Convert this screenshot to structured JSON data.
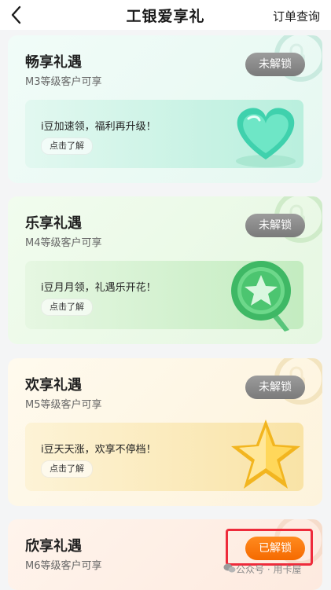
{
  "header": {
    "title": "工银爱享礼",
    "order_link": "订单查询"
  },
  "cards": [
    {
      "title": "畅享礼遇",
      "subtitle": "M3等级客户可享",
      "badge": "未解锁",
      "banner_text": "i豆加速领，福利再升级！",
      "button": "点击了解",
      "art": "heart-icon",
      "colors": {
        "bg": "#eefbf6",
        "banner": "#c9f3e6"
      }
    },
    {
      "title": "乐享礼遇",
      "subtitle": "M4等级客户可享",
      "badge": "未解锁",
      "banner_text": "i豆月月领，礼遇乐开花！",
      "button": "点击了解",
      "art": "star-medal-icon",
      "colors": {
        "bg": "#effbec",
        "banner": "#cfeecb"
      }
    },
    {
      "title": "欢享礼遇",
      "subtitle": "M5等级客户可享",
      "badge": "未解锁",
      "banner_text": "i豆天天涨，欢享不停档！",
      "button": "点击了解",
      "art": "gold-star-icon",
      "colors": {
        "bg": "#fdf8ea",
        "banner": "#fbedbd"
      }
    },
    {
      "title": "欣享礼遇",
      "subtitle": "M6等级客户可享",
      "badge": "已解锁",
      "colors": {
        "bg": "#fdf1ea"
      }
    }
  ],
  "watermark": "公众号 · 用卡屋",
  "colors": {
    "locked_badge": "#8a8a8a",
    "unlocked_badge": "#f56a00",
    "highlight": "#ee2b3b"
  }
}
